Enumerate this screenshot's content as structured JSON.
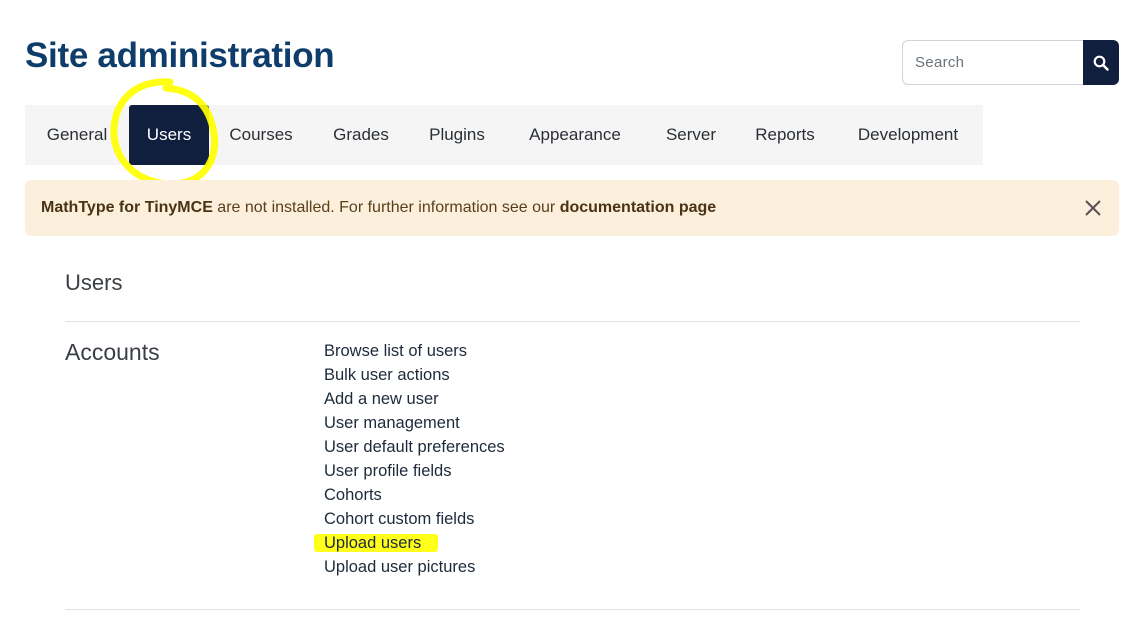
{
  "header": {
    "title": "Site administration"
  },
  "search": {
    "placeholder": "Search"
  },
  "tabs": [
    {
      "label": "General"
    },
    {
      "label": "Users"
    },
    {
      "label": "Courses"
    },
    {
      "label": "Grades"
    },
    {
      "label": "Plugins"
    },
    {
      "label": "Appearance"
    },
    {
      "label": "Server"
    },
    {
      "label": "Reports"
    },
    {
      "label": "Development"
    }
  ],
  "active_tab": "Users",
  "alert": {
    "strong_1": "MathType for TinyMCE",
    "text": " are not installed. For further information see our ",
    "strong_2": "documentation page"
  },
  "section": {
    "heading": "Users"
  },
  "accounts": {
    "heading": "Accounts",
    "links": [
      "Browse list of users",
      "Bulk user actions",
      "Add a new user",
      "User management",
      "User default preferences",
      "User profile fields",
      "Cohorts",
      "Cohort custom fields",
      "Upload users",
      "Upload user pictures"
    ]
  },
  "colors": {
    "title": "#0f3d6b",
    "active_tab_bg": "#0f1f3d",
    "alert_bg": "#fcefdc",
    "annotation_highlight": "#ffff00"
  }
}
